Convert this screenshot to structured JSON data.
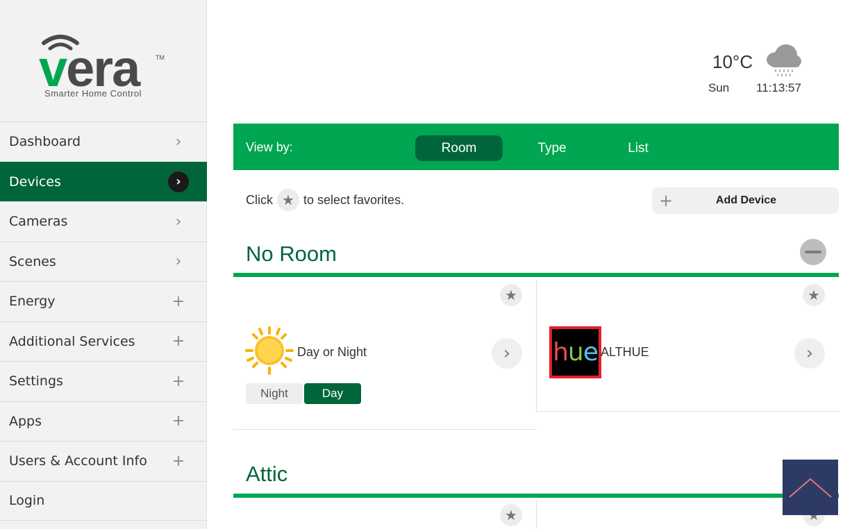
{
  "brand": {
    "name": "vera",
    "tm": "TM",
    "tagline": "Smarter Home Control",
    "colors": {
      "primary_green": "#00a651",
      "dark_green": "#00663a"
    }
  },
  "sidebar": {
    "items": [
      {
        "label": "Dashboard",
        "icon": "chevron-right-icon",
        "active": false
      },
      {
        "label": "Devices",
        "icon": "chevron-right-icon",
        "active": true
      },
      {
        "label": "Cameras",
        "icon": "chevron-right-icon",
        "active": false
      },
      {
        "label": "Scenes",
        "icon": "chevron-right-icon",
        "active": false
      },
      {
        "label": "Energy",
        "icon": "plus-icon",
        "active": false
      },
      {
        "label": "Additional Services",
        "icon": "plus-icon",
        "active": false
      },
      {
        "label": "Settings",
        "icon": "plus-icon",
        "active": false
      },
      {
        "label": "Apps",
        "icon": "plus-icon",
        "active": false
      },
      {
        "label": "Users & Account Info",
        "icon": "plus-icon",
        "active": false
      },
      {
        "label": "Login",
        "icon": "",
        "active": false
      }
    ]
  },
  "weather": {
    "temperature": "10°C",
    "day": "Sun",
    "time": "11:13:57",
    "icon": "cloud-rain-icon"
  },
  "viewbar": {
    "label": "View by:",
    "tabs": [
      {
        "label": "Room",
        "selected": true
      },
      {
        "label": "Type",
        "selected": false
      },
      {
        "label": "List",
        "selected": false
      }
    ]
  },
  "favorites_hint": {
    "before": "Click",
    "after": "to select favorites."
  },
  "add_device": {
    "label": "Add Device"
  },
  "rooms": [
    {
      "name": "No Room",
      "devices": [
        {
          "name": "Day or Night",
          "icon": "sun-icon",
          "toggle": {
            "off_label": "Night",
            "on_label": "Day",
            "value": "Day"
          }
        },
        {
          "name": "ALTHUE",
          "icon": "hue-logo",
          "logo_text": "hue"
        }
      ]
    },
    {
      "name": "Attic"
    }
  ]
}
